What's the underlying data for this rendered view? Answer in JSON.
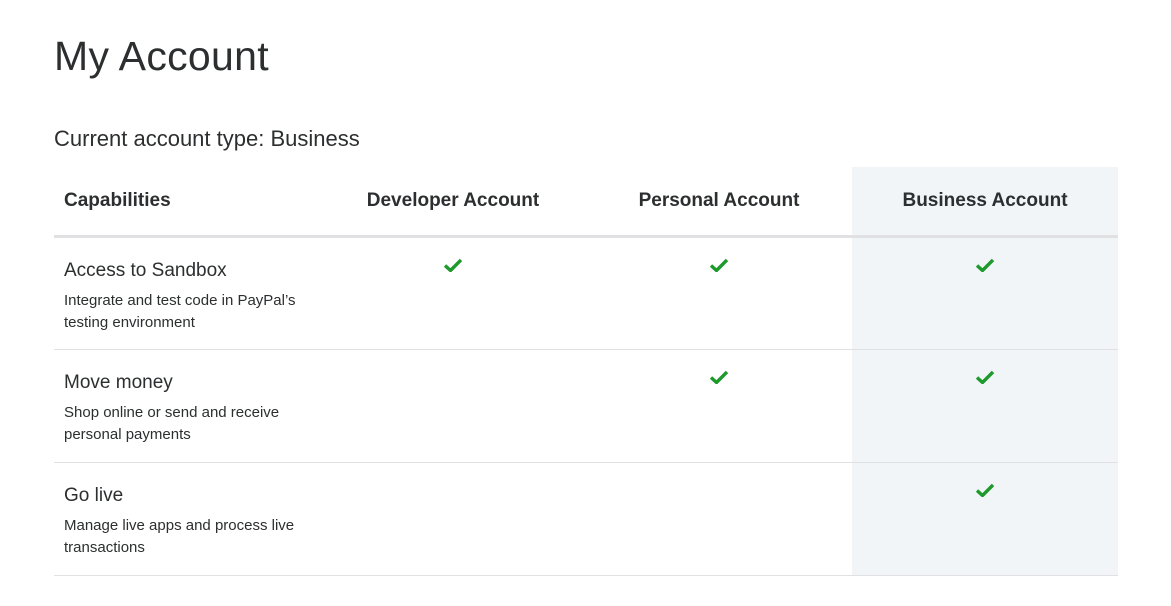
{
  "page": {
    "title": "My Account",
    "account_type": "Current account type: Business"
  },
  "table": {
    "headers": [
      "Capabilities",
      "Developer Account",
      "Personal Account",
      "Business Account"
    ],
    "rows": [
      {
        "title": "Access to Sandbox",
        "description": "Integrate and test code in PayPal’s testing environment",
        "developer": true,
        "personal": true,
        "business": true
      },
      {
        "title": "Move money",
        "description": "Shop online or send and receive personal payments",
        "developer": false,
        "personal": true,
        "business": true
      },
      {
        "title": "Go live",
        "description": "Manage live apps and process live transactions",
        "developer": false,
        "personal": false,
        "business": true
      }
    ]
  },
  "colors": {
    "check": "#1e9a2c",
    "highlight": "#f1f5f8"
  }
}
